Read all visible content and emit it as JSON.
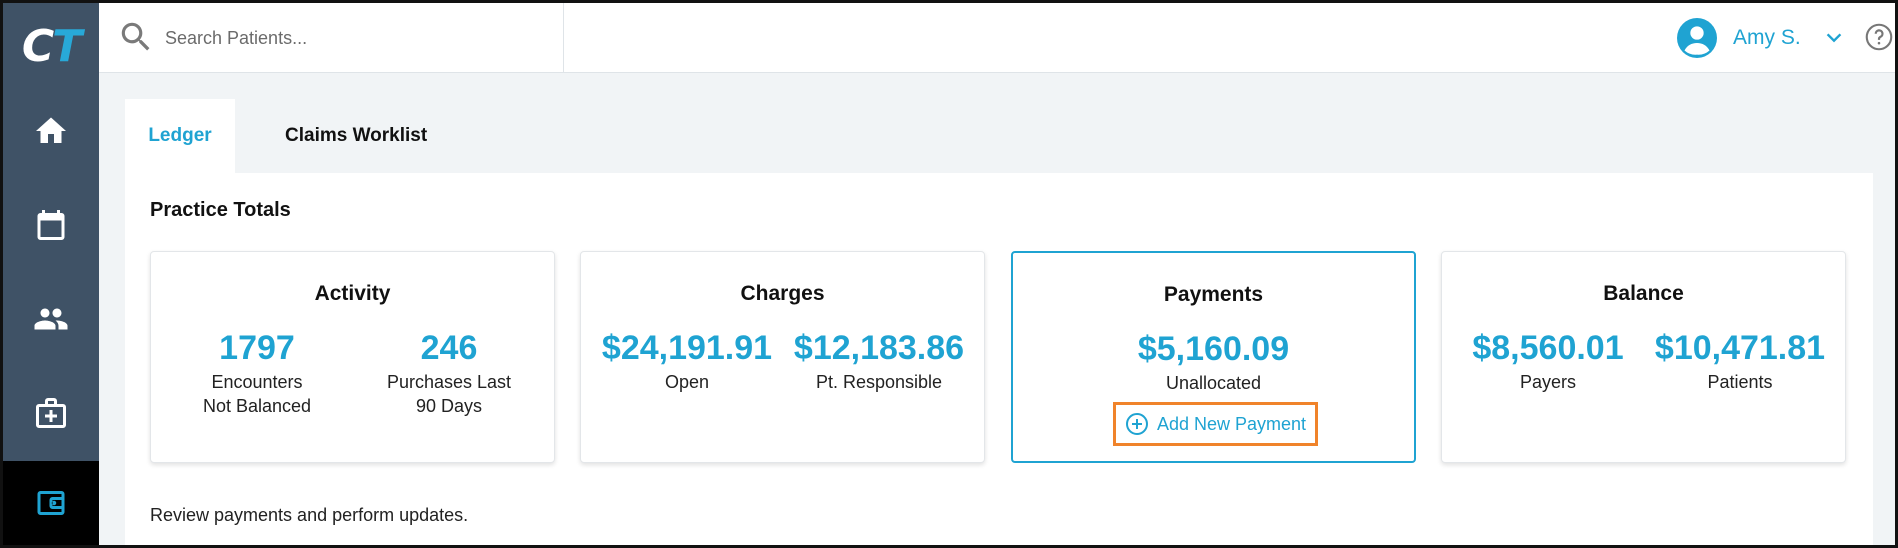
{
  "app": {
    "logo_letter_1": "C",
    "logo_letter_2": "T",
    "accent_color": "#1fa3d2",
    "sidebar_color": "#3f5266",
    "highlight_color": "#f0832a"
  },
  "sidebar": {
    "items": [
      {
        "name": "home",
        "icon": "home-icon",
        "active": false
      },
      {
        "name": "calendar",
        "icon": "calendar-icon",
        "active": false
      },
      {
        "name": "patients",
        "icon": "people-icon",
        "active": false
      },
      {
        "name": "clinical",
        "icon": "medical-kit-icon",
        "active": false
      },
      {
        "name": "billing",
        "icon": "wallet-icon",
        "active": true
      }
    ]
  },
  "topbar": {
    "search_placeholder": "Search Patients...",
    "user_name": "Amy S.",
    "help_icon": "help-icon"
  },
  "tabs": [
    {
      "label": "Ledger",
      "active": true
    },
    {
      "label": "Claims Worklist",
      "active": false
    }
  ],
  "section_title": "Practice Totals",
  "cards": {
    "activity": {
      "title": "Activity",
      "stats": [
        {
          "value": "1797",
          "label_line1": "Encounters",
          "label_line2": "Not Balanced"
        },
        {
          "value": "246",
          "label_line1": "Purchases Last",
          "label_line2": "90 Days"
        }
      ]
    },
    "charges": {
      "title": "Charges",
      "stats": [
        {
          "value": "$24,191.91",
          "label_line1": "Open"
        },
        {
          "value": "$12,183.86",
          "label_line1": "Pt. Responsible"
        }
      ]
    },
    "payments": {
      "title": "Payments",
      "stats": [
        {
          "value": "$5,160.09",
          "label_line1": "Unallocated"
        }
      ],
      "action_label": "Add New Payment"
    },
    "balance": {
      "title": "Balance",
      "stats": [
        {
          "value": "$8,560.01",
          "label_line1": "Payers"
        },
        {
          "value": "$10,471.81",
          "label_line1": "Patients"
        }
      ]
    }
  },
  "footer_note": "Review payments and perform updates."
}
